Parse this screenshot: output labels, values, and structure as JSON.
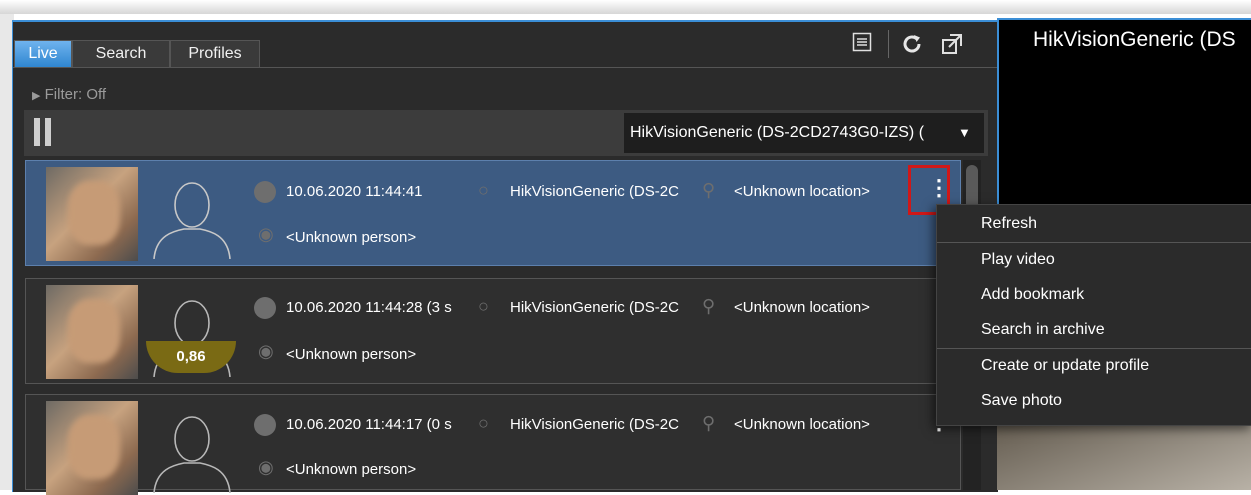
{
  "tabs": [
    {
      "label": "Live",
      "active": true
    },
    {
      "label": "Search",
      "active": false
    },
    {
      "label": "Profiles",
      "active": false
    }
  ],
  "filter": {
    "label": "Filter:",
    "value": "Off"
  },
  "camera_select": {
    "value": "HikVisionGeneric (DS-2CD2743G0-IZS) ("
  },
  "video_panel": {
    "title": "HikVisionGeneric (DS"
  },
  "events": [
    {
      "timestamp": "10.06.2020 11:44:41",
      "camera": "HikVisionGeneric (DS-2C",
      "location": "<Unknown location>",
      "person": "<Unknown person>",
      "match_score": null,
      "selected": true
    },
    {
      "timestamp": "10.06.2020 11:44:28 (3 s",
      "camera": "HikVisionGeneric (DS-2C",
      "location": "<Unknown location>",
      "person": "<Unknown person>",
      "match_score": "0,86",
      "selected": false
    },
    {
      "timestamp": "10.06.2020 11:44:17 (0 s",
      "camera": "HikVisionGeneric (DS-2C",
      "location": "<Unknown location>",
      "person": "<Unknown person>",
      "match_score": null,
      "selected": false
    }
  ],
  "context_menu": {
    "items": [
      {
        "label": "Refresh"
      },
      {
        "label": "Play video"
      },
      {
        "label": "Add bookmark"
      },
      {
        "label": "Search in archive"
      },
      {
        "label": "Create or update profile"
      },
      {
        "label": "Save photo"
      }
    ]
  },
  "colors": {
    "accent": "#3b8ed6",
    "selected_row": "#3d5b82",
    "highlight": "#d01818",
    "match_badge": "#7a6a14"
  }
}
